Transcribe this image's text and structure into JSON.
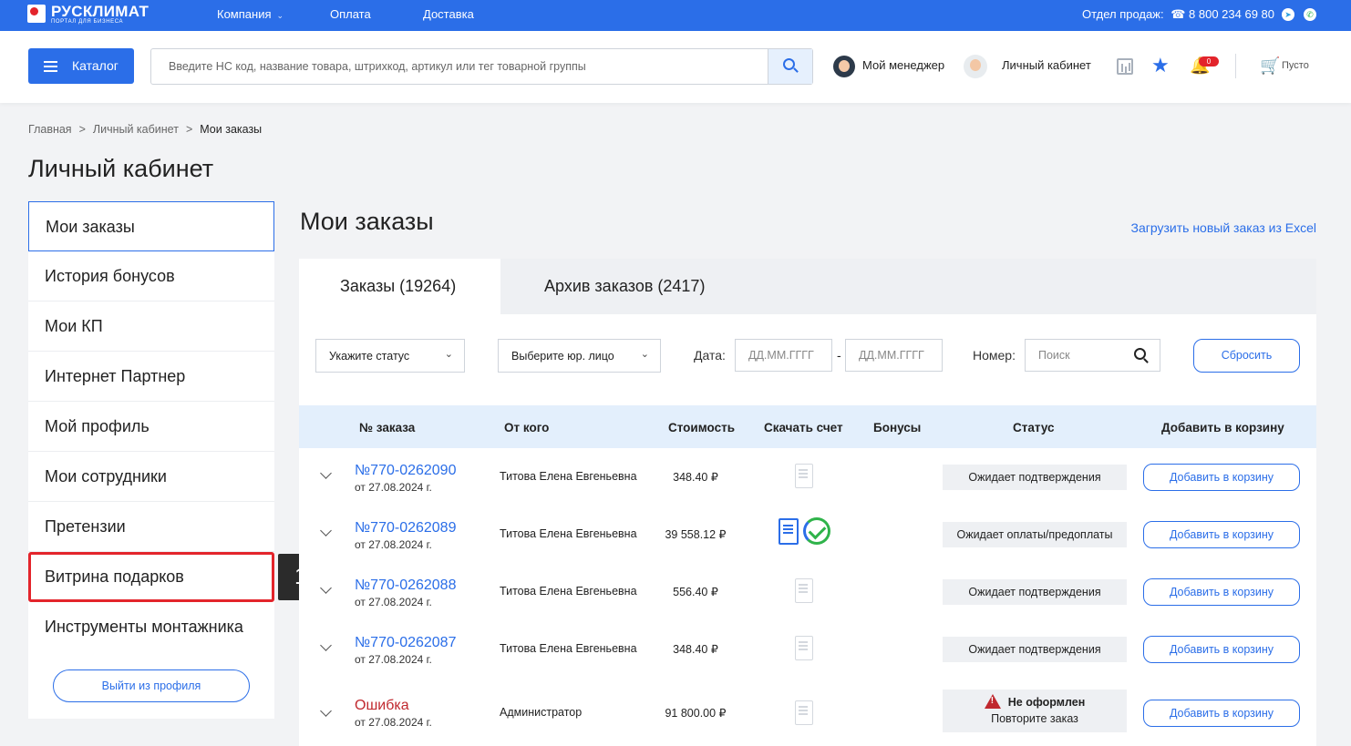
{
  "topbar": {
    "logo_text": "РУСКЛИМАТ",
    "logo_subtitle": "ПОРТАЛ ДЛЯ БИЗНЕСА",
    "nav": [
      "Компания",
      "Оплата",
      "Доставка"
    ],
    "sales_label": "Отдел продаж:",
    "phone": "8 800 234 69 80",
    "accent_color": "#2b6ee8"
  },
  "header": {
    "catalog_label": "Каталог",
    "search_placeholder": "Введите НС код, название товара, штрихкод, артикул или тег товарной группы",
    "manager_label": "Мой менеджер",
    "cabinet_label": "Личный кабинет",
    "notification_count": "0",
    "cart_label": "Пусто"
  },
  "breadcrumb": [
    "Главная",
    "Личный кабинет",
    "Мои заказы"
  ],
  "page_title": "Личный кабинет",
  "sidebar": {
    "items": [
      {
        "label": "Мои заказы",
        "active": true
      },
      {
        "label": "История бонусов"
      },
      {
        "label": "Мои КП"
      },
      {
        "label": "Интернет Партнер"
      },
      {
        "label": "Мой профиль"
      },
      {
        "label": "Мои сотрудники"
      },
      {
        "label": "Претензии"
      },
      {
        "label": "Витрина подарков",
        "highlighted": true
      },
      {
        "label": "Инструменты монтажника"
      }
    ],
    "logout_label": "Выйти из профиля",
    "highlight_marker": "1"
  },
  "main": {
    "title": "Мои заказы",
    "excel_link": "Загрузить новый заказ из Excel",
    "tabs": [
      "Заказы (19264)",
      "Архив заказов (2417)"
    ],
    "filters": {
      "status_placeholder": "Укажите статус",
      "entity_placeholder": "Выберите юр. лицо",
      "date_label": "Дата:",
      "date_from_placeholder": "ДД.ММ.ГГГГ",
      "date_to_placeholder": "ДД.ММ.ГГГГ",
      "number_label": "Номер:",
      "number_placeholder": "Поиск",
      "reset_label": "Сбросить"
    },
    "columns": [
      "№ заказа",
      "От кого",
      "Стоимость",
      "Скачать счет",
      "Бонусы",
      "Статус",
      "Добавить в корзину"
    ],
    "orders": [
      {
        "number": "№770-0262090",
        "date": "от 27.08.2024 г.",
        "from": "Титова Елена Евгеньевна",
        "cost": "348.40 ₽",
        "status": "Ожидает подтверждения",
        "add_label": "Добавить в корзину"
      },
      {
        "number": "№770-0262089",
        "date": "от 27.08.2024 г.",
        "from": "Титова Елена Евгеньевна",
        "cost": "39 558.12 ₽",
        "status": "Ожидает оплаты/предоплаты",
        "add_label": "Добавить в корзину"
      },
      {
        "number": "№770-0262088",
        "date": "от 27.08.2024 г.",
        "from": "Титова Елена Евгеньевна",
        "cost": "556.40 ₽",
        "status": "Ожидает подтверждения",
        "add_label": "Добавить в корзину"
      },
      {
        "number": "№770-0262087",
        "date": "от 27.08.2024 г.",
        "from": "Титова Елена Евгеньевна",
        "cost": "348.40 ₽",
        "status": "Ожидает подтверждения",
        "add_label": "Добавить в корзину"
      },
      {
        "number": "Ошибка",
        "date": "от 27.08.2024 г.",
        "from": "Администратор",
        "cost": "91 800.00 ₽",
        "status": "Не оформлен",
        "status_sub": "Повторите заказ",
        "add_label": "Добавить в корзину"
      }
    ]
  }
}
